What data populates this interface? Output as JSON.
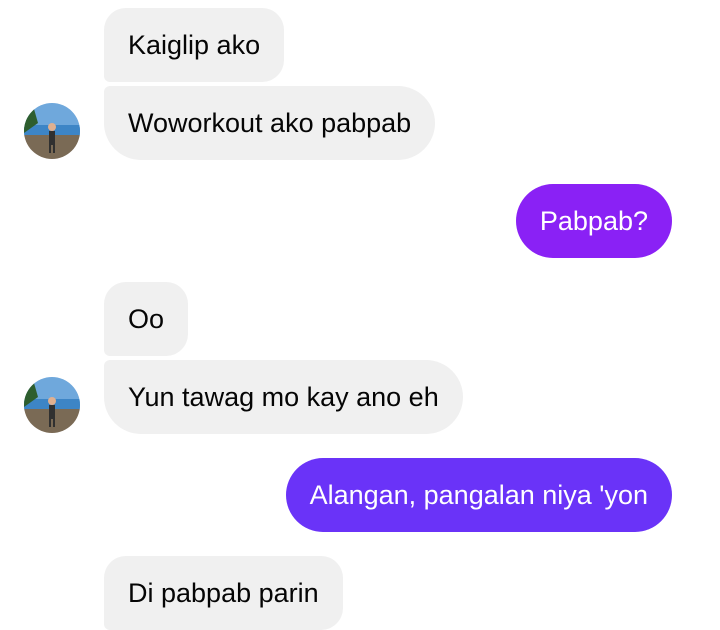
{
  "messages": [
    {
      "sender": "them",
      "text": "Kaiglip ako"
    },
    {
      "sender": "them",
      "text": "Woworkout ako pabpab"
    },
    {
      "sender": "me",
      "text": "Pabpab?"
    },
    {
      "sender": "them",
      "text": "Oo"
    },
    {
      "sender": "them",
      "text": "Yun tawag mo kay ano eh"
    },
    {
      "sender": "me",
      "text": "Alangan, pangalan niya 'yon"
    },
    {
      "sender": "them",
      "text": "Di pabpab parin"
    }
  ],
  "colors": {
    "incoming_bubble": "#f0f0f0",
    "incoming_text": "#050505",
    "outgoing_top": "#8a21f5",
    "outgoing_bottom": "#6a33f8"
  },
  "avatar_icon": "profile-photo-beach"
}
